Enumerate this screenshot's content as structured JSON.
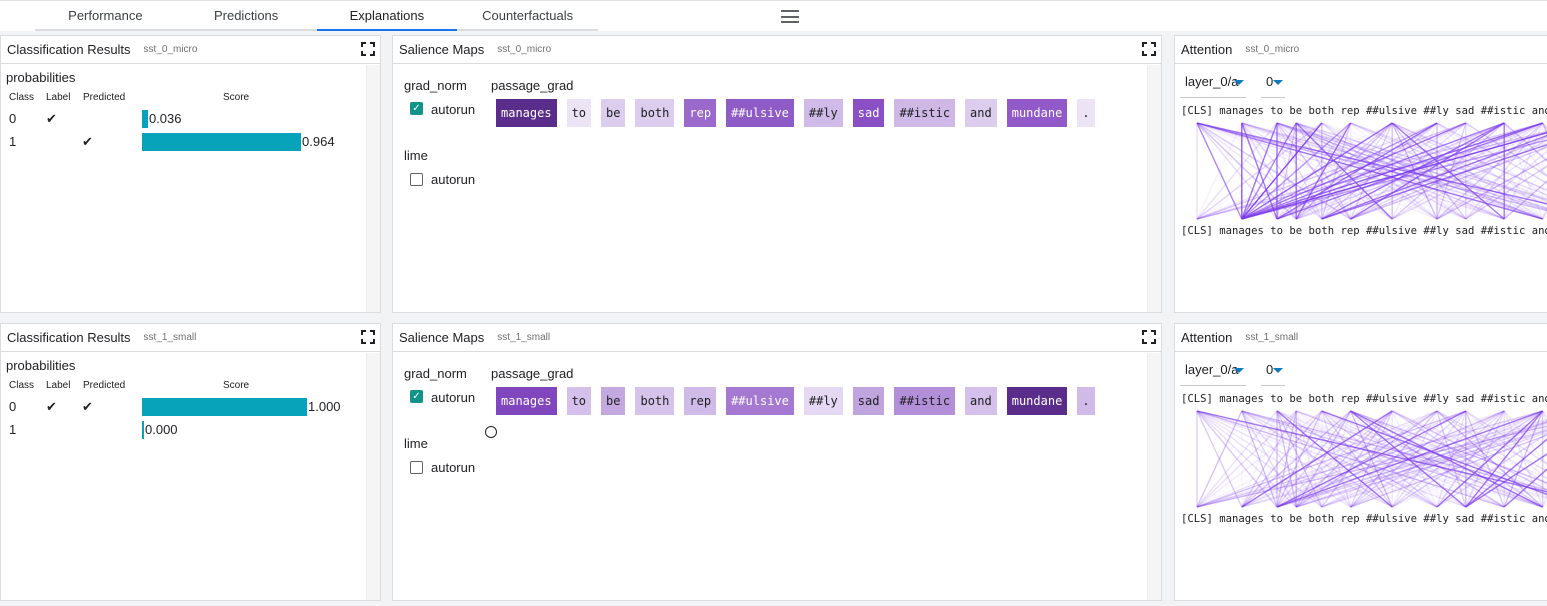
{
  "tabs": [
    {
      "label": "Performance"
    },
    {
      "label": "Predictions"
    },
    {
      "label": "Explanations",
      "active": true
    },
    {
      "label": "Counterfactuals"
    }
  ],
  "menu_icon": "hamburger-menu-icon",
  "accent": "#1a73e8",
  "bar_color": "#07a3bb",
  "rows": [
    {
      "classification": {
        "title": "Classification Results",
        "model": "sst_0_micro",
        "section": "probabilities",
        "headers": {
          "class": "Class",
          "label": "Label",
          "predicted": "Predicted",
          "score": "Score"
        },
        "rows": [
          {
            "class": "0",
            "label": "✔",
            "predicted": "",
            "score": "0.036",
            "value": 0.036
          },
          {
            "class": "1",
            "label": "",
            "predicted": "✔",
            "score": "0.964",
            "value": 0.964
          }
        ]
      },
      "salience": {
        "title": "Salience Maps",
        "model": "sst_0_micro",
        "methods": [
          {
            "name": "grad_norm",
            "field": "passage_grad",
            "autorun_label": "autorun",
            "autorun": true
          },
          {
            "name": "lime",
            "autorun_label": "autorun",
            "autorun": false
          }
        ],
        "tokens": [
          {
            "t": "manages",
            "c": "#5b2d8a",
            "dark": true
          },
          {
            "t": "to",
            "c": "#ece4f5"
          },
          {
            "t": "be",
            "c": "#dccdee"
          },
          {
            "t": "both",
            "c": "#dccdee"
          },
          {
            "t": "rep",
            "c": "#9b69cc",
            "dark": true
          },
          {
            "t": "##ulsive",
            "c": "#8e5bc7",
            "dark": true
          },
          {
            "t": "##ly",
            "c": "#d0bae8"
          },
          {
            "t": "sad",
            "c": "#8a4fc5",
            "dark": true
          },
          {
            "t": "##istic",
            "c": "#cfb8e6"
          },
          {
            "t": "and",
            "c": "#dccdee"
          },
          {
            "t": "mundane",
            "c": "#9259c9",
            "dark": true
          },
          {
            "t": ".",
            "c": "#ece4f5"
          }
        ]
      },
      "attention": {
        "title": "Attention",
        "model": "sst_0_micro",
        "layer": "layer_0/a",
        "head": "0",
        "tokens": "[CLS] manages to be both rep ##ulsive ##ly sad ##istic and mundane ."
      }
    },
    {
      "classification": {
        "title": "Classification Results",
        "model": "sst_1_small",
        "section": "probabilities",
        "headers": {
          "class": "Class",
          "label": "Label",
          "predicted": "Predicted",
          "score": "Score"
        },
        "rows": [
          {
            "class": "0",
            "label": "✔",
            "predicted": "✔",
            "score": "1.000",
            "value": 1.0
          },
          {
            "class": "1",
            "label": "",
            "predicted": "",
            "score": "0.000",
            "value": 0.0
          }
        ]
      },
      "salience": {
        "title": "Salience Maps",
        "model": "sst_1_small",
        "methods": [
          {
            "name": "grad_norm",
            "field": "passage_grad",
            "autorun_label": "autorun",
            "autorun": true
          },
          {
            "name": "lime",
            "autorun_label": "autorun",
            "autorun": false
          }
        ],
        "tokens": [
          {
            "t": "manages",
            "c": "#7f46bd",
            "dark": true
          },
          {
            "t": "to",
            "c": "#d4c0ea"
          },
          {
            "t": "be",
            "c": "#c4a9e1"
          },
          {
            "t": "both",
            "c": "#d6c3eb"
          },
          {
            "t": "rep",
            "c": "#d0bae8"
          },
          {
            "t": "##ulsive",
            "c": "#a579d2",
            "dark": true
          },
          {
            "t": "##ly",
            "c": "#e4d8f2"
          },
          {
            "t": "sad",
            "c": "#c0a4de"
          },
          {
            "t": "##istic",
            "c": "#b38ed9"
          },
          {
            "t": "and",
            "c": "#d4c0ea"
          },
          {
            "t": "mundane",
            "c": "#5b2d8a",
            "dark": true
          },
          {
            "t": ".",
            "c": "#d0bae8"
          }
        ]
      },
      "attention": {
        "title": "Attention",
        "model": "sst_1_small",
        "layer": "layer_0/a",
        "head": "0",
        "tokens": "[CLS] manages to be both rep ##ulsive ##ly sad ##istic and mundane ."
      }
    }
  ]
}
